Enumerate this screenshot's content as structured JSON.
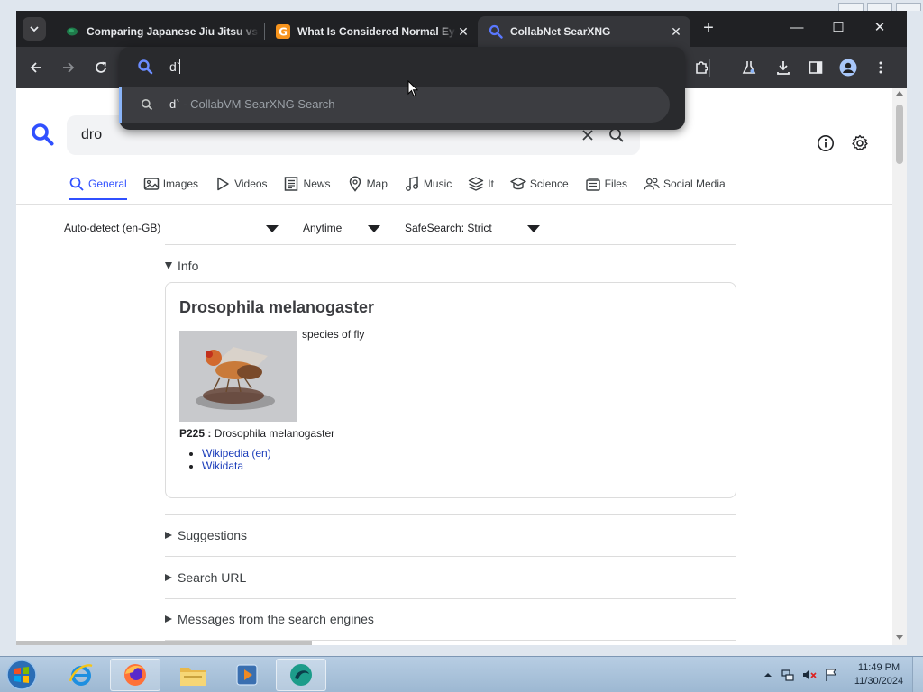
{
  "browser": {
    "tabs": [
      {
        "title": "Comparing Japanese Jiu Jitsu vs",
        "active": false,
        "favicon": "green-blob-icon"
      },
      {
        "title": "What Is Considered Normal Eye",
        "active": false,
        "favicon": "g-letter-icon"
      },
      {
        "title": "CollabNet SearXNG",
        "active": true,
        "favicon": "magnifier-icon"
      }
    ],
    "close_glyph": "✕",
    "new_tab_glyph": "+",
    "window_controls": {
      "minimize": "—",
      "maximize": "☐",
      "close": "✕"
    }
  },
  "omnibox": {
    "value": "d`",
    "suggestion": {
      "query": "d`",
      "separator": " - ",
      "source": "CollabVM SearXNG Search"
    }
  },
  "search": {
    "query": "dro",
    "categories": [
      {
        "label": "General",
        "icon": "search-icon",
        "active": true
      },
      {
        "label": "Images",
        "icon": "image-icon",
        "active": false
      },
      {
        "label": "Videos",
        "icon": "play-icon",
        "active": false
      },
      {
        "label": "News",
        "icon": "newspaper-icon",
        "active": false
      },
      {
        "label": "Map",
        "icon": "map-pin-icon",
        "active": false
      },
      {
        "label": "Music",
        "icon": "music-note-icon",
        "active": false
      },
      {
        "label": "It",
        "icon": "layers-icon",
        "active": false
      },
      {
        "label": "Science",
        "icon": "school-icon",
        "active": false
      },
      {
        "label": "Files",
        "icon": "files-icon",
        "active": false
      },
      {
        "label": "Social Media",
        "icon": "people-icon",
        "active": false
      }
    ],
    "filters": {
      "language": "Auto-detect (en-GB)",
      "time": "Anytime",
      "safesearch": "SafeSearch: Strict"
    }
  },
  "infobox": {
    "section_label": "Info",
    "title": "Drosophila melanogaster",
    "description": "species of fly",
    "property_label": "P225 :",
    "property_value": "Drosophila melanogaster",
    "links": [
      "Wikipedia (en)",
      "Wikidata"
    ]
  },
  "sections": {
    "suggestions": "Suggestions",
    "search_url": "Search URL",
    "messages": "Messages from the search engines"
  },
  "taskbar": {
    "time": "11:49 PM",
    "date": "11/30/2024",
    "apps": [
      "internet-explorer-icon",
      "firefox-icon",
      "file-explorer-icon",
      "media-player-icon",
      "browser-app-icon"
    ]
  },
  "colors": {
    "accent": "#3050ff",
    "link": "#1a3cba",
    "chrome_dark": "#202124",
    "omnibox_accent": "#8ab4f8"
  }
}
